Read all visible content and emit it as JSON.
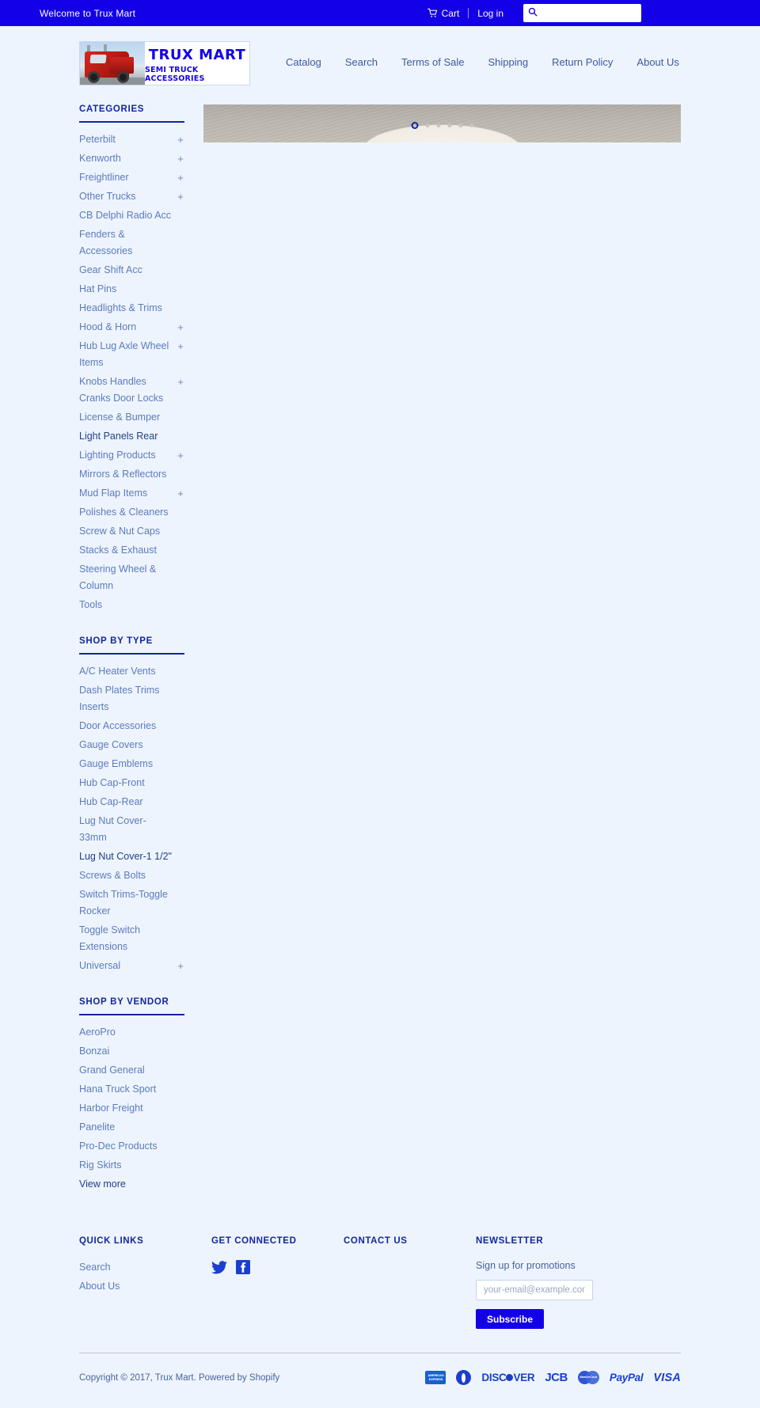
{
  "topbar": {
    "welcome": "Welcome to Trux Mart",
    "cart_label": "Cart",
    "login_label": "Log in",
    "search_placeholder": "",
    "search_value": ""
  },
  "logo": {
    "title": "TRUX MART",
    "subtitle": "SEMI TRUCK ACCESSORIES"
  },
  "nav": {
    "items": [
      {
        "label": "Catalog"
      },
      {
        "label": "Search"
      },
      {
        "label": "Terms of Sale"
      },
      {
        "label": "Shipping"
      },
      {
        "label": "Return Policy"
      },
      {
        "label": "About Us"
      }
    ]
  },
  "sidebar": {
    "categories": {
      "title": "CATEGORIES",
      "items": [
        {
          "label": "Peterbilt",
          "expandable": true,
          "active": false
        },
        {
          "label": "Kenworth",
          "expandable": true,
          "active": false
        },
        {
          "label": "Freightliner",
          "expandable": true,
          "active": false
        },
        {
          "label": "Other Trucks",
          "expandable": true,
          "active": false
        },
        {
          "label": "CB Delphi Radio Acc",
          "expandable": false,
          "active": false
        },
        {
          "label": "Fenders & Accessories",
          "expandable": false,
          "active": false
        },
        {
          "label": "Gear Shift Acc",
          "expandable": false,
          "active": false
        },
        {
          "label": "Hat Pins",
          "expandable": false,
          "active": false
        },
        {
          "label": "Headlights & Trims",
          "expandable": false,
          "active": false
        },
        {
          "label": "Hood & Horn",
          "expandable": true,
          "active": false
        },
        {
          "label": "Hub Lug Axle Wheel Items",
          "expandable": true,
          "active": false
        },
        {
          "label": "Knobs Handles Cranks Door Locks",
          "expandable": true,
          "active": false
        },
        {
          "label": "License & Bumper",
          "expandable": false,
          "active": false
        },
        {
          "label": "Light Panels Rear",
          "expandable": false,
          "active": true
        },
        {
          "label": "Lighting Products",
          "expandable": true,
          "active": false
        },
        {
          "label": "Mirrors & Reflectors",
          "expandable": false,
          "active": false
        },
        {
          "label": "Mud Flap Items",
          "expandable": true,
          "active": false
        },
        {
          "label": "Polishes & Cleaners",
          "expandable": false,
          "active": false
        },
        {
          "label": "Screw & Nut Caps",
          "expandable": false,
          "active": false
        },
        {
          "label": "Stacks & Exhaust",
          "expandable": false,
          "active": false
        },
        {
          "label": "Steering Wheel & Column",
          "expandable": false,
          "active": false
        },
        {
          "label": "Tools",
          "expandable": false,
          "active": false
        }
      ]
    },
    "shop_by_type": {
      "title": "SHOP BY TYPE",
      "items": [
        {
          "label": "A/C Heater Vents",
          "expandable": false,
          "active": false
        },
        {
          "label": "Dash Plates Trims Inserts",
          "expandable": false,
          "active": false
        },
        {
          "label": "Door Accessories",
          "expandable": false,
          "active": false
        },
        {
          "label": "Gauge Covers",
          "expandable": false,
          "active": false
        },
        {
          "label": "Gauge Emblems",
          "expandable": false,
          "active": false
        },
        {
          "label": "Hub Cap-Front",
          "expandable": false,
          "active": false
        },
        {
          "label": "Hub Cap-Rear",
          "expandable": false,
          "active": false
        },
        {
          "label": "Lug Nut Cover-33mm",
          "expandable": false,
          "active": false
        },
        {
          "label": "Lug Nut Cover-1 1/2\"",
          "expandable": false,
          "active": true
        },
        {
          "label": "Screws & Bolts",
          "expandable": false,
          "active": false
        },
        {
          "label": "Switch Trims-Toggle Rocker",
          "expandable": false,
          "active": false
        },
        {
          "label": "Toggle Switch Extensions",
          "expandable": false,
          "active": false
        },
        {
          "label": "Universal",
          "expandable": true,
          "active": false
        }
      ]
    },
    "shop_by_vendor": {
      "title": "SHOP BY VENDOR",
      "items": [
        {
          "label": "AeroPro",
          "expandable": false,
          "active": false
        },
        {
          "label": "Bonzai",
          "expandable": false,
          "active": false
        },
        {
          "label": "Grand General",
          "expandable": false,
          "active": false
        },
        {
          "label": "Hana Truck Sport",
          "expandable": false,
          "active": false
        },
        {
          "label": "Harbor Freight",
          "expandable": false,
          "active": false
        },
        {
          "label": "Panelite",
          "expandable": false,
          "active": false
        },
        {
          "label": "Pro-Dec Products",
          "expandable": false,
          "active": false
        },
        {
          "label": "Rig Skirts",
          "expandable": false,
          "active": false
        },
        {
          "label": "View more",
          "expandable": false,
          "active": true
        }
      ]
    }
  },
  "slideshow": {
    "dots": [
      {
        "active": true
      },
      {
        "active": false
      },
      {
        "active": false
      },
      {
        "active": false
      },
      {
        "active": false
      },
      {
        "active": false
      }
    ]
  },
  "footer": {
    "quick_links": {
      "title": "QUICK LINKS",
      "items": [
        {
          "label": "Search"
        },
        {
          "label": "About Us"
        }
      ]
    },
    "get_connected": {
      "title": "GET CONNECTED",
      "icons": [
        "twitter-icon",
        "facebook-icon"
      ]
    },
    "contact_us": {
      "title": "CONTACT US"
    },
    "newsletter": {
      "title": "NEWSLETTER",
      "note": "Sign up for promotions",
      "email_placeholder": "your-email@example.com",
      "email_value": "",
      "subscribe_label": "Subscribe"
    },
    "copyright": "Copyright © 2017, Trux Mart. Powered by Shopify",
    "payment_methods": [
      "american-express",
      "diners-club",
      "discover",
      "jcb",
      "mastercard",
      "paypal",
      "visa"
    ]
  },
  "colors": {
    "brand_blue": "#1400e6",
    "heading_blue": "#12269e",
    "link_blue": "#5b7bbd",
    "page_bg": "#eef4fd"
  }
}
